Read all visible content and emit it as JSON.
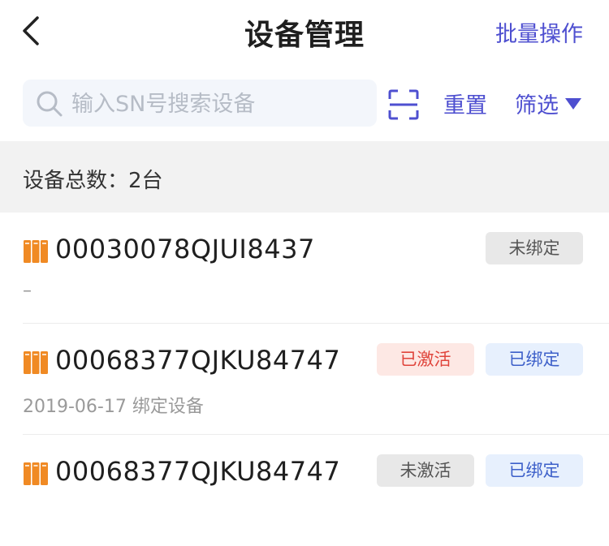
{
  "nav": {
    "title": "设备管理",
    "batch_label": "批量操作"
  },
  "search": {
    "placeholder": "输入SN号搜索设备",
    "value": ""
  },
  "toolbar": {
    "reset_label": "重置",
    "filter_label": "筛选"
  },
  "summary": {
    "text": "设备总数：2台"
  },
  "devices": [
    {
      "sn": "00030078QJUI8437",
      "sub": "–",
      "activation": "",
      "binding": "未绑定",
      "binding_style": "gray"
    },
    {
      "sn": "00068377QJKU84747",
      "sub": "2019-06-17   绑定设备",
      "activation": "已激活",
      "binding": "已绑定",
      "activation_style": "red",
      "binding_style": "blue"
    },
    {
      "sn": "00068377QJKU84747",
      "sub": "",
      "activation": "未激活",
      "binding": "已绑定",
      "activation_style": "gray",
      "binding_style": "blue"
    }
  ],
  "colors": {
    "accent": "#4e4fd0",
    "device_icon": "#f08a24",
    "search_bg": "#f3f6fb",
    "count_bg": "#f2f2f2"
  },
  "icons": {
    "back": "chevron-left-icon",
    "search": "search-icon",
    "scan": "scan-icon",
    "filter": "triangle-down-icon",
    "device": "device-icon"
  }
}
